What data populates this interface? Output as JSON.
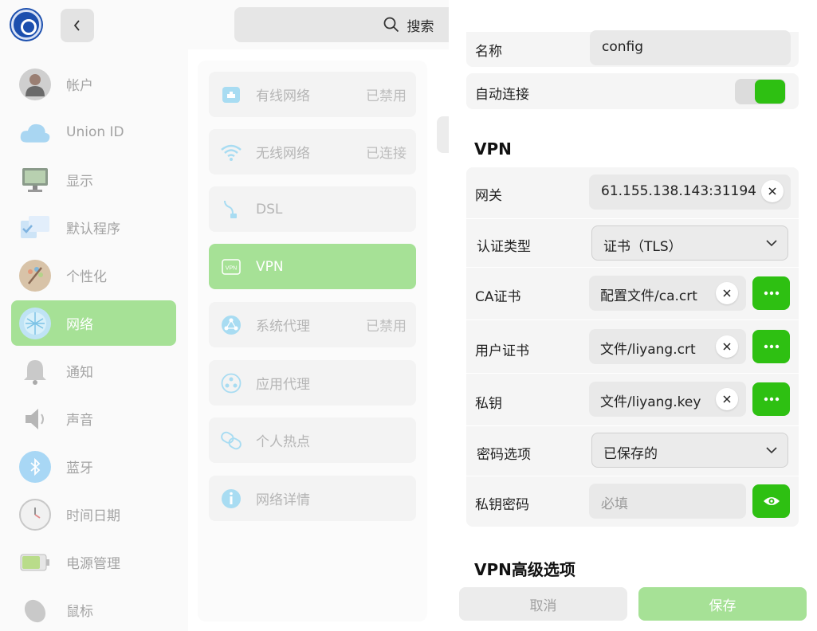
{
  "header": {
    "search_label": "搜索"
  },
  "sidebar": {
    "items": [
      {
        "label": "帐户",
        "icon": "account-icon"
      },
      {
        "label": "Union ID",
        "icon": "cloud-icon"
      },
      {
        "label": "显示",
        "icon": "display-icon"
      },
      {
        "label": "默认程序",
        "icon": "default-apps-icon"
      },
      {
        "label": "个性化",
        "icon": "personalization-icon"
      },
      {
        "label": "网络",
        "icon": "network-icon",
        "active": true
      },
      {
        "label": "通知",
        "icon": "bell-icon"
      },
      {
        "label": "声音",
        "icon": "speaker-icon"
      },
      {
        "label": "蓝牙",
        "icon": "bluetooth-icon"
      },
      {
        "label": "时间日期",
        "icon": "clock-icon"
      },
      {
        "label": "电源管理",
        "icon": "battery-icon"
      },
      {
        "label": "鼠标",
        "icon": "mouse-icon"
      }
    ]
  },
  "network_menu": {
    "items": [
      {
        "label": "有线网络",
        "status": "已禁用",
        "icon": "wired-icon"
      },
      {
        "label": "无线网络",
        "status": "已连接",
        "icon": "wifi-icon"
      },
      {
        "label": "DSL",
        "status": "",
        "icon": "dsl-icon"
      },
      {
        "label": "VPN",
        "status": "",
        "icon": "vpn-icon",
        "active": true
      },
      {
        "label": "系统代理",
        "status": "已禁用",
        "icon": "system-proxy-icon"
      },
      {
        "label": "应用代理",
        "status": "",
        "icon": "app-proxy-icon"
      },
      {
        "label": "个人热点",
        "status": "",
        "icon": "hotspot-icon"
      },
      {
        "label": "网络详情",
        "status": "",
        "icon": "info-icon"
      }
    ]
  },
  "vpn_form": {
    "name_label": "名称",
    "name_value": "config",
    "auto_connect_label": "自动连接",
    "auto_connect_on": true,
    "vpn_section_title": "VPN",
    "gateway_label": "网关",
    "gateway_value": "61.155.138.143:31194",
    "auth_type_label": "认证类型",
    "auth_type_value": "证书（TLS）",
    "ca_cert_label": "CA证书",
    "ca_cert_value": "\u0000配置文件/ca.crt",
    "user_cert_label": "用户证书",
    "user_cert_value": "\u0000文件/liyang.crt",
    "private_key_label": "私钥",
    "private_key_value": "文件/liyang.key",
    "password_option_label": "密码选项",
    "password_option_value": "已保存的",
    "key_password_label": "私钥密码",
    "key_password_placeholder": "必填",
    "advanced_section_title": "VPN高级选项"
  },
  "footer": {
    "cancel_label": "取消",
    "save_label": "保存"
  },
  "colors": {
    "accent_green": "#2ec012",
    "active_bg": "#a6e196"
  }
}
